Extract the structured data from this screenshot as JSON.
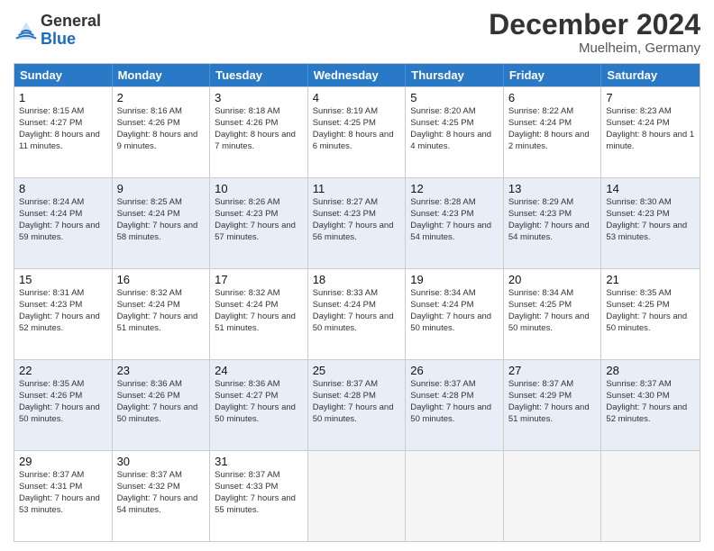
{
  "header": {
    "logo_general": "General",
    "logo_blue": "Blue",
    "month_title": "December 2024",
    "location": "Muelheim, Germany"
  },
  "days_of_week": [
    "Sunday",
    "Monday",
    "Tuesday",
    "Wednesday",
    "Thursday",
    "Friday",
    "Saturday"
  ],
  "weeks": [
    {
      "alt": false,
      "cells": [
        {
          "day": "1",
          "sunrise": "8:15 AM",
          "sunset": "4:27 PM",
          "daylight": "8 hours and 11 minutes."
        },
        {
          "day": "2",
          "sunrise": "8:16 AM",
          "sunset": "4:26 PM",
          "daylight": "8 hours and 9 minutes."
        },
        {
          "day": "3",
          "sunrise": "8:18 AM",
          "sunset": "4:26 PM",
          "daylight": "8 hours and 7 minutes."
        },
        {
          "day": "4",
          "sunrise": "8:19 AM",
          "sunset": "4:25 PM",
          "daylight": "8 hours and 6 minutes."
        },
        {
          "day": "5",
          "sunrise": "8:20 AM",
          "sunset": "4:25 PM",
          "daylight": "8 hours and 4 minutes."
        },
        {
          "day": "6",
          "sunrise": "8:22 AM",
          "sunset": "4:24 PM",
          "daylight": "8 hours and 2 minutes."
        },
        {
          "day": "7",
          "sunrise": "8:23 AM",
          "sunset": "4:24 PM",
          "daylight": "8 hours and 1 minute."
        }
      ]
    },
    {
      "alt": true,
      "cells": [
        {
          "day": "8",
          "sunrise": "8:24 AM",
          "sunset": "4:24 PM",
          "daylight": "7 hours and 59 minutes."
        },
        {
          "day": "9",
          "sunrise": "8:25 AM",
          "sunset": "4:24 PM",
          "daylight": "7 hours and 58 minutes."
        },
        {
          "day": "10",
          "sunrise": "8:26 AM",
          "sunset": "4:23 PM",
          "daylight": "7 hours and 57 minutes."
        },
        {
          "day": "11",
          "sunrise": "8:27 AM",
          "sunset": "4:23 PM",
          "daylight": "7 hours and 56 minutes."
        },
        {
          "day": "12",
          "sunrise": "8:28 AM",
          "sunset": "4:23 PM",
          "daylight": "7 hours and 54 minutes."
        },
        {
          "day": "13",
          "sunrise": "8:29 AM",
          "sunset": "4:23 PM",
          "daylight": "7 hours and 54 minutes."
        },
        {
          "day": "14",
          "sunrise": "8:30 AM",
          "sunset": "4:23 PM",
          "daylight": "7 hours and 53 minutes."
        }
      ]
    },
    {
      "alt": false,
      "cells": [
        {
          "day": "15",
          "sunrise": "8:31 AM",
          "sunset": "4:23 PM",
          "daylight": "7 hours and 52 minutes."
        },
        {
          "day": "16",
          "sunrise": "8:32 AM",
          "sunset": "4:24 PM",
          "daylight": "7 hours and 51 minutes."
        },
        {
          "day": "17",
          "sunrise": "8:32 AM",
          "sunset": "4:24 PM",
          "daylight": "7 hours and 51 minutes."
        },
        {
          "day": "18",
          "sunrise": "8:33 AM",
          "sunset": "4:24 PM",
          "daylight": "7 hours and 50 minutes."
        },
        {
          "day": "19",
          "sunrise": "8:34 AM",
          "sunset": "4:24 PM",
          "daylight": "7 hours and 50 minutes."
        },
        {
          "day": "20",
          "sunrise": "8:34 AM",
          "sunset": "4:25 PM",
          "daylight": "7 hours and 50 minutes."
        },
        {
          "day": "21",
          "sunrise": "8:35 AM",
          "sunset": "4:25 PM",
          "daylight": "7 hours and 50 minutes."
        }
      ]
    },
    {
      "alt": true,
      "cells": [
        {
          "day": "22",
          "sunrise": "8:35 AM",
          "sunset": "4:26 PM",
          "daylight": "7 hours and 50 minutes."
        },
        {
          "day": "23",
          "sunrise": "8:36 AM",
          "sunset": "4:26 PM",
          "daylight": "7 hours and 50 minutes."
        },
        {
          "day": "24",
          "sunrise": "8:36 AM",
          "sunset": "4:27 PM",
          "daylight": "7 hours and 50 minutes."
        },
        {
          "day": "25",
          "sunrise": "8:37 AM",
          "sunset": "4:28 PM",
          "daylight": "7 hours and 50 minutes."
        },
        {
          "day": "26",
          "sunrise": "8:37 AM",
          "sunset": "4:28 PM",
          "daylight": "7 hours and 50 minutes."
        },
        {
          "day": "27",
          "sunrise": "8:37 AM",
          "sunset": "4:29 PM",
          "daylight": "7 hours and 51 minutes."
        },
        {
          "day": "28",
          "sunrise": "8:37 AM",
          "sunset": "4:30 PM",
          "daylight": "7 hours and 52 minutes."
        }
      ]
    },
    {
      "alt": false,
      "cells": [
        {
          "day": "29",
          "sunrise": "8:37 AM",
          "sunset": "4:31 PM",
          "daylight": "7 hours and 53 minutes."
        },
        {
          "day": "30",
          "sunrise": "8:37 AM",
          "sunset": "4:32 PM",
          "daylight": "7 hours and 54 minutes."
        },
        {
          "day": "31",
          "sunrise": "8:37 AM",
          "sunset": "4:33 PM",
          "daylight": "7 hours and 55 minutes."
        },
        {
          "day": "",
          "sunrise": "",
          "sunset": "",
          "daylight": ""
        },
        {
          "day": "",
          "sunrise": "",
          "sunset": "",
          "daylight": ""
        },
        {
          "day": "",
          "sunrise": "",
          "sunset": "",
          "daylight": ""
        },
        {
          "day": "",
          "sunrise": "",
          "sunset": "",
          "daylight": ""
        }
      ]
    }
  ],
  "labels": {
    "sunrise": "Sunrise:",
    "sunset": "Sunset:",
    "daylight": "Daylight:"
  }
}
